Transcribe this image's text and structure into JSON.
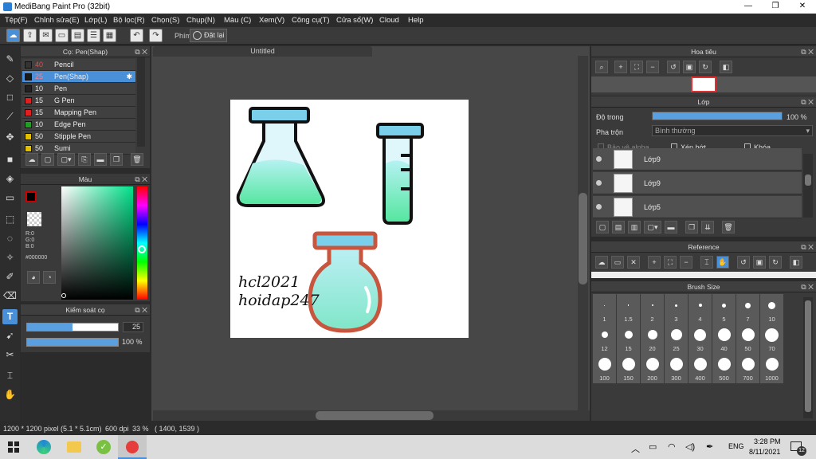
{
  "window": {
    "title": "MediBang Paint Pro (32bit)",
    "minimize": "—",
    "maximize": "❐",
    "close": "✕"
  },
  "menu": [
    "Tệp(F)",
    "Chỉnh sửa(E)",
    "Lớp(L)",
    "Bộ lọc(R)",
    "Chọn(S)",
    "Chụp(N)",
    "Màu (C)",
    "Xem(V)",
    "Công cụ(T)",
    "Cửa sổ(W)",
    "Cloud",
    "Help"
  ],
  "toolbar": {
    "shortcut_label": "Phím",
    "reset_label": "Đặt lại"
  },
  "brush_panel": {
    "title": "Cọ: Pen(Shap)",
    "brushes": [
      {
        "size": "40",
        "name": "Pencil",
        "color": "#333333",
        "selected": false
      },
      {
        "size": "25",
        "name": "Pen(Shap)",
        "color": "#1a1a1a",
        "selected": true
      },
      {
        "size": "10",
        "name": "Pen",
        "color": "#222222",
        "selected": false
      },
      {
        "size": "15",
        "name": "G Pen",
        "color": "#e02020",
        "selected": false
      },
      {
        "size": "15",
        "name": "Mapping Pen",
        "color": "#e02020",
        "selected": false
      },
      {
        "size": "10",
        "name": "Edge Pen",
        "color": "#20a020",
        "selected": false
      },
      {
        "size": "50",
        "name": "Stipple Pen",
        "color": "#e0c000",
        "selected": false
      },
      {
        "size": "50",
        "name": "Sumi",
        "color": "#e0c000",
        "selected": false
      }
    ]
  },
  "color_panel": {
    "title": "Màu",
    "r": "R:0",
    "g": "G:0",
    "b": "B:0",
    "hex": "#000000"
  },
  "control_panel": {
    "title": "Kiểm soát cọ",
    "size_value": "25",
    "size_fraction": 0.5,
    "opacity_value": "100 %",
    "opacity_fraction": 1.0
  },
  "canvas": {
    "tab": "Untitled",
    "text_line1": "hcl2021",
    "text_line2": "hoidap247"
  },
  "navigator": {
    "title": "Hoa tiêu"
  },
  "layer_panel": {
    "title": "Lớp",
    "opacity_label": "Độ trong",
    "opacity_value": "100 %",
    "opacity_fraction": 1.0,
    "blend_label": "Pha trộn",
    "blend_value": "Bình thường",
    "protect_alpha": "Bảo vệ alpha",
    "clipping": "Xén bớt",
    "lock": "Khóa",
    "layers": [
      "Lớp9",
      "Lớp9",
      "Lớp5"
    ]
  },
  "reference_panel": {
    "title": "Reference"
  },
  "brush_size_panel": {
    "title": "Brush Size",
    "sizes": [
      "1",
      "1.5",
      "2",
      "3",
      "4",
      "5",
      "7",
      "10",
      "12",
      "15",
      "20",
      "25",
      "30",
      "40",
      "50",
      "70",
      "100",
      "150",
      "200",
      "300",
      "400",
      "500",
      "700",
      "1000"
    ]
  },
  "status": {
    "dims": "1200 * 1200 pixel",
    "physical": "(5.1 * 5.1cm)",
    "dpi": "600 dpi",
    "zoom": "33 %",
    "coords": "( 1400, 1539 )"
  },
  "taskbar": {
    "lang": "ENG",
    "time": "3:28 PM",
    "date": "8/11/2021",
    "notif": "12"
  },
  "colors": {
    "accent": "#4a90d9",
    "bg": "#2b2b2b",
    "panel": "#3a3a3a"
  }
}
